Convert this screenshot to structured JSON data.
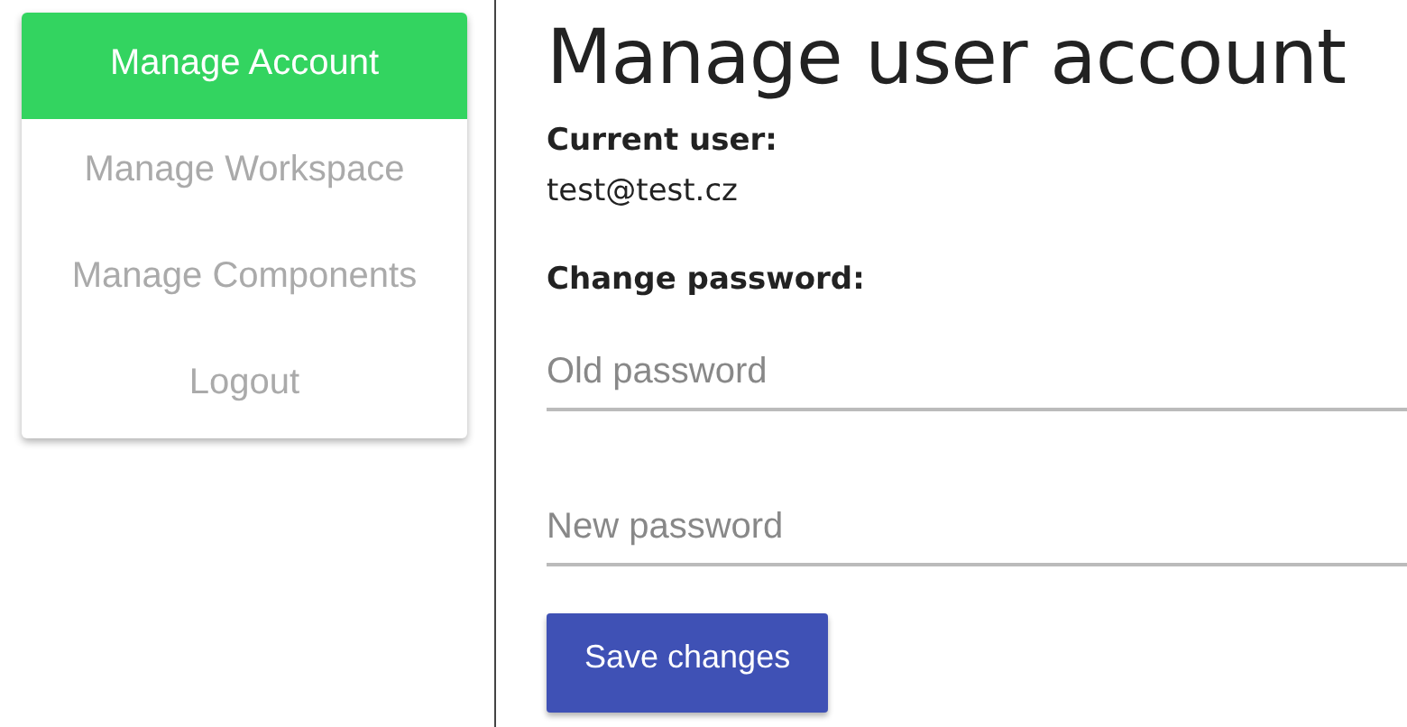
{
  "sidebar": {
    "items": [
      {
        "label": "Manage Account",
        "selected": true
      },
      {
        "label": "Manage Workspace",
        "selected": false
      },
      {
        "label": "Manage Components",
        "selected": false
      },
      {
        "label": "Logout",
        "selected": false
      }
    ]
  },
  "main": {
    "title": "Manage user account",
    "current_user_label": "Current user:",
    "current_user": "test@test.cz",
    "change_password_label": "Change password:",
    "fields": [
      {
        "placeholder": "Old password"
      },
      {
        "placeholder": "New password"
      }
    ],
    "button": "Save changes"
  }
}
